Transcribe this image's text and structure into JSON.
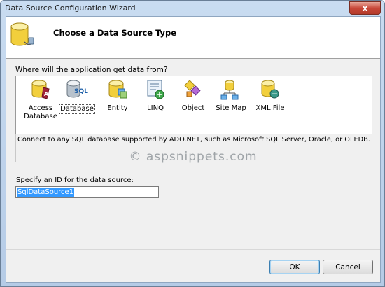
{
  "window": {
    "title": "Data Source Configuration Wizard",
    "close_glyph": "x"
  },
  "header": {
    "title": "Choose a Data Source Type",
    "icon": "database-plug-icon"
  },
  "question": {
    "access_key": "W",
    "rest": "here will the application get data from?"
  },
  "types": [
    {
      "id": "access",
      "label_line1": "Access",
      "label_line2": "Database",
      "icon": "access-database-icon",
      "selected": false
    },
    {
      "id": "database",
      "label_line1": "Database",
      "label_line2": "",
      "icon": "sql-database-icon",
      "selected": true
    },
    {
      "id": "entity",
      "label_line1": "Entity",
      "label_line2": "",
      "icon": "entity-icon",
      "selected": false
    },
    {
      "id": "linq",
      "label_line1": "LINQ",
      "label_line2": "",
      "icon": "linq-icon",
      "selected": false
    },
    {
      "id": "object",
      "label_line1": "Object",
      "label_line2": "",
      "icon": "object-icon",
      "selected": false
    },
    {
      "id": "sitemap",
      "label_line1": "Site Map",
      "label_line2": "",
      "icon": "site-map-icon",
      "selected": false
    },
    {
      "id": "xml",
      "label_line1": "XML File",
      "label_line2": "",
      "icon": "xml-file-icon",
      "selected": false
    }
  ],
  "sql_text": "SQL",
  "description": "Connect to any SQL database supported by ADO.NET, such as Microsoft SQL Server, Oracle, or OLEDB.",
  "watermark": "© aspsnippets.com",
  "id_field": {
    "label_pre": "Specify an ",
    "label_key": "I",
    "label_post": "D for the data source:",
    "value": "SqlDataSource1"
  },
  "buttons": {
    "ok": "OK",
    "cancel": "Cancel"
  },
  "colors": {
    "selection": "#3399ff",
    "title_bar": "#c9dcf1",
    "close_button": "#c8483a"
  }
}
